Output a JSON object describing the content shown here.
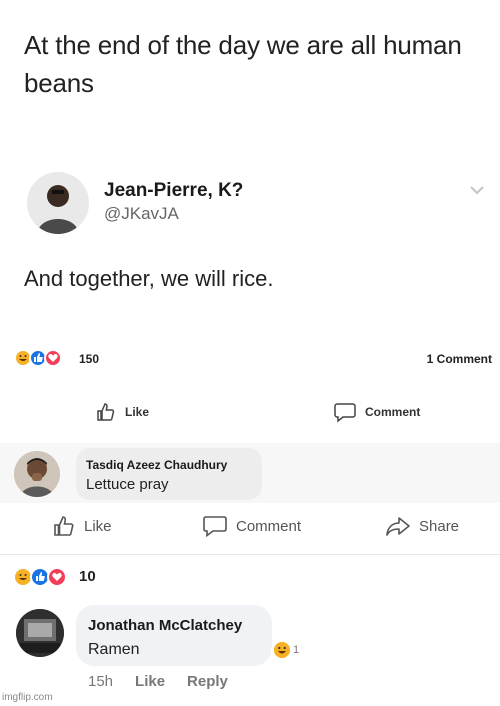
{
  "post": {
    "text": "At the end of the day we are all human beans"
  },
  "tweet": {
    "author_name": "Jean-Pierre, K?",
    "handle": "@JKavJA",
    "text": "And together, we will rice."
  },
  "reactions_1": {
    "count": "150",
    "comments": "1 Comment",
    "icons": [
      "haha-icon",
      "like-icon",
      "love-icon"
    ]
  },
  "actions_1": {
    "like": "Like",
    "comment": "Comment"
  },
  "comment_1": {
    "author": "Tasdiq Azeez Chaudhury",
    "text": "Lettuce pray"
  },
  "actions_2": {
    "like": "Like",
    "comment": "Comment",
    "share": "Share"
  },
  "reactions_2": {
    "count": "10"
  },
  "comment_2": {
    "author": "Jonathan McClatchey",
    "text": "Ramen",
    "reaction_count": "1",
    "time": "15h",
    "like": "Like",
    "reply": "Reply"
  },
  "watermark": "imgflip.com",
  "colors": {
    "haha": "#f7b125",
    "like": "#1b74e4",
    "love": "#f33e58"
  }
}
